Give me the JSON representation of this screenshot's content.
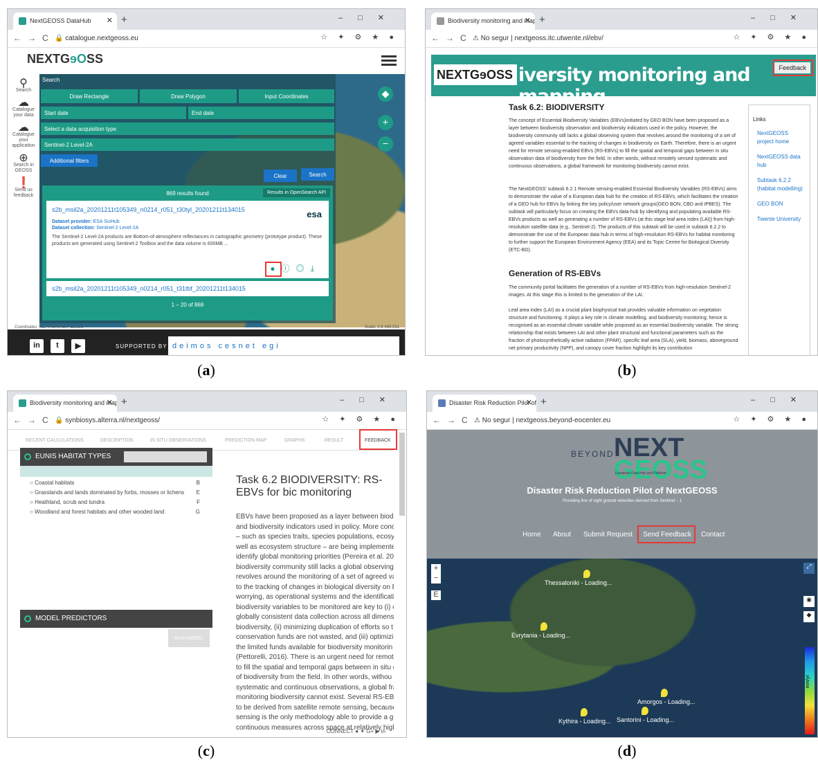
{
  "captions": [
    "a",
    "b",
    "c",
    "d"
  ],
  "a": {
    "tab_title": "NextGEOSS DataHub",
    "url": "catalogue.nextgeoss.eu",
    "logo_pre": "NEXTG",
    "logo_mid": "ɘO",
    "logo_post": "SS",
    "sidebar": [
      "Search",
      "Catalogue your data",
      "Catalogue your application",
      "Search in GEOSS",
      "Send us feedback"
    ],
    "search_label": "Search",
    "btn_rect": "Draw Rectangle",
    "btn_poly": "Draw Polygon",
    "btn_coords": "Input Coordinates",
    "start_date": "Start date",
    "end_date": "End date",
    "acq_type": "Select a data acquisition type",
    "product": "Sentinel-2 Level-2A",
    "filters": "Additional filters",
    "clear": "Clear",
    "search": "Search",
    "results_count": "869 results found",
    "opensearch": "Results in OpenSearch API",
    "result1_title": "s2b_msil2a_20201211t105349_n0214_r051_t30tyl_20201211t134015",
    "provider_label": "Dataset provider:",
    "provider": "ESA SciHub",
    "collection_label": "Dataset collection:",
    "collection": "Sentinel-2 Level-2A",
    "description": "The Sentinel-2 Level-2A products are Bottom-of-atmosphere reflectances in cartographic geometry (prototype product). These products are generated using Sentinel-2 Toolbox and the data volume is 600MB ...",
    "esa": "esa",
    "result2_title": "s2b_msil2a_20201211t105349_n0214_r051_t31tbf_20201211t134015",
    "pager": "1 – 20 of 869",
    "coords": "Coordinates - lat: 44.840 lon: -12.393",
    "scale": "Scale: 1:9 489,031",
    "supported_by": "SUPPORTED BY",
    "sponsors": "deimos cesnet egi"
  },
  "b": {
    "tab_title": "Biodiversity monitoring and map",
    "url": "No segur | nextgeoss.itc.utwente.nl/ebv/",
    "logo": "NEXTGɘOSS",
    "banner": "iversity monitoring and mapping",
    "feedback": "Feedback",
    "title": "Task 6.2: BIODIVERSITY",
    "p1": "The concept of Essential Biodiversity Variables (EBVs)initiated by GEO BON have been proposed as a layer between biodiversity observation and biodiversity indicators used in the policy. However, the biodiversity community still lacks a global observing system that revolves around the monitoring of a set of agreed variables essential to the tracking of changes in biodiversity on Earth. Therefore, there is an urgent need for remote sensing-enabled EBVs (RS-EBVs) to fill the spatial and temporal gaps between in situ observation data of biodiversity from the field. In other words, without remotely sensed systematic and continuous observations, a global framework for monitoring biodiversity cannot exist.",
    "p2": "The NextGEOSS' subtask 6.2.1 Remote sensing-enabled Essential Biodiversity Variables (RS-EBVs) aims to demonstrate the value of a European data hub for the creation of RS-EBVs, which facilitates the creation of a GEO hub for EBVs by linking the key policy/user network groups(GEO BON, CBD and IPBES). The subtask will particularly focus on creating the EBVs data-hub by identifying and populating available RS-EBVs products as well as generating a number of RS-EBVs (at this stage leaf area index (LAI)) from high-resolution satellite data (e.g., Sentinel-2). The products of this subtask will be used in subtask 6.2.2 to demonstrate the use of the European data hub in terms of high-resolution RS-EBVs for habitat monitoring to further support the European Environment Agency (EEA) and its Topic Centre for Biological Diversity (ETC-BD).",
    "h2": "Generation of RS-EBVs",
    "p3": "The community portal facilitates the generation of a number of RS-EBVs from high-resolution Sentinel-2 images. At this stage this is limited to the generation of the LAI.",
    "p4": "Leaf area index (LAI) as a crucial plant biophysical trait provides valuable information on vegetation structure and functioning. It plays a key role in climate modelling, and biodiversity monitoring; hence is recognised as an essential climate variable while proposed as an essential biodiversity variable. The strong relationship that exists between LAI and other plant structural and functional parameters such as the fraction of photosynthetically active radiation (FPAR), specific leaf area (SLA), yield, biomass, aboveground net primary productivity (NPP), and canopy cover fraction highlight its key contribution",
    "links_title": "Links",
    "links": [
      "NextGEOSS project home",
      "NextGEOSS data hub",
      "Subtask 6.2.2 (habitat modelling)",
      "GEO BON",
      "Twente University"
    ]
  },
  "c": {
    "tab_title": "Biodiversity monitoring and map",
    "url": "synbiosys.alterra.nl/nextgeoss/",
    "tabs": [
      "RECENT CALCULATIONS",
      "DESCRIPTION",
      "IN SITU OBSERVATIONS",
      "PREDICTION MAP",
      "GRAPHS",
      "RESULT",
      "FEEDBACK"
    ],
    "eunis": "EUNIS HABITAT TYPES",
    "habitats": [
      [
        "Coastal habitats",
        "B"
      ],
      [
        "Grasslands and lands dominated by forbs, mosses or lichens",
        "E"
      ],
      [
        "Heathland, scrub and tundra",
        "F"
      ],
      [
        "Woodland and forest habitats and other wooded land",
        "G"
      ]
    ],
    "model": "MODEL PREDICTORS",
    "run": "RUN MODEL",
    "title": "Task 6.2 BIODIVERSITY: RS-EBVs for bic monitoring",
    "lines": [
      "EBVs have been proposed as a layer between biodive",
      "and biodiversity indicators used in policy. More conc",
      "– such as species traits, species populations, ecosyst",
      "well as ecosystem structure – are being implementec",
      "identify global monitoring priorities (Pereira et al. 20",
      "biodiversity community still lacks a global observing",
      "revolves around the monitoring of a set of agreed va",
      "to the tracking of changes in biological diversity on E",
      "worrying, as operational systems and the identificati",
      "biodiversity variables to be monitored are key to (i) c",
      "globally consistent data collection across all dimensic",
      "biodiversity, (ii) minimizing duplication of efforts so t",
      "conservation funds are not wasted, and (iii) optimizir",
      "the limited funds available for biodiversity monitorin",
      "(Pettorelli, 2016). There is an urgent need for remote",
      "to fill the spatial and temporal gaps between in situ c",
      "of biodiversity from the field. In other words, withou",
      "systematic and continuous observations, a global fra",
      "monitoring biodiversity cannot exist. Several RS-EBV:",
      "to be derived from satellite remote sensing, because",
      "sensing is the only methodology able to provide a glc",
      "continuous measures across space at relatively high"
    ],
    "connect": "CONNECT"
  },
  "d": {
    "tab_title": "Disaster Risk Reduction Pilot of N",
    "url": "No segur | nextgeoss.beyond-eocenter.eu",
    "beyond": "BEYOND",
    "next": "NEXT",
    "geoss": "GEOSS",
    "sub": "European Data Hub and Platform",
    "title": "Disaster Risk Reduction Pilot of NextGEOSS",
    "tagline": "Providing line of sight ground velocities derived from Sentinel – 1",
    "nav": [
      "Home",
      "About",
      "Submit Request",
      "Send Feedback",
      "Contact"
    ],
    "pins": [
      "Thessaloniki - Loading...",
      "Evrytania - Loading...",
      "Amorgos - Loading...",
      "Santorini - Loading...",
      "Kythira - Loading..."
    ],
    "legend": "mm/yr",
    "e": "E"
  }
}
